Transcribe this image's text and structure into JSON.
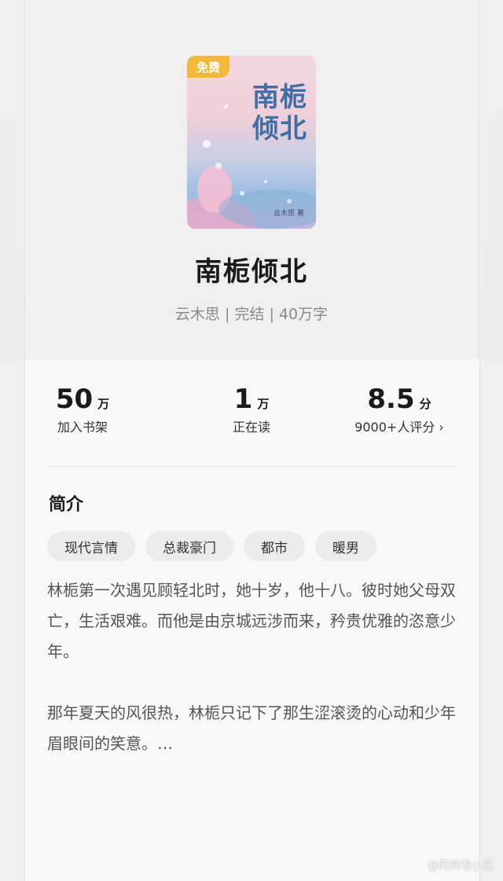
{
  "book": {
    "free_badge": "免费",
    "cover_title_line1": "南栀",
    "cover_title_line2": "倾北",
    "cover_author": "云木思 著",
    "title": "南栀倾北",
    "meta": "云木思 | 完结 | 40万字"
  },
  "stats": {
    "shelf": {
      "value": "50",
      "unit": "万",
      "label": "加入书架"
    },
    "reading": {
      "value": "1",
      "unit": "万",
      "label": "正在读"
    },
    "rating": {
      "value": "8.5",
      "unit": "分",
      "label": "9000+人评分 ›"
    }
  },
  "intro": {
    "heading": "简介",
    "tags": [
      "现代言情",
      "总裁豪门",
      "都市",
      "暖男"
    ],
    "paragraph1": "林栀第一次遇见顾轻北时，她十岁，他十八。彼时她父母双亡，生活艰难。而他是由京城远涉而来，矜贵优雅的恣意少年。",
    "paragraph2": "那年夏天的风很热，林栀只记下了那生涩滚烫的心动和少年眉眼间的笑意。…"
  },
  "watermark": "@阿宾看小说",
  "colors": {
    "badge": "#f1b83a",
    "cover_title": "#3f6fa6"
  }
}
